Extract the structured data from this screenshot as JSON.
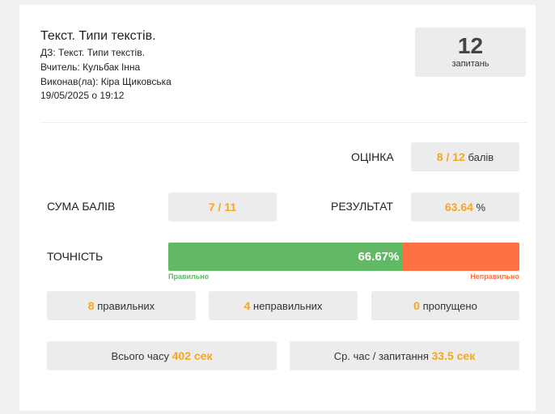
{
  "header": {
    "title": "Текст. Типи текстів.",
    "homework": "ДЗ: Текст. Типи текстів.",
    "teacher": "Вчитель: Кульбак Інна",
    "performer": "Виконав(ла): Кіра Щиковська",
    "datetime": "19/05/2025 о 19:12"
  },
  "questions": {
    "count": "12",
    "label": "запитань"
  },
  "grade": {
    "label": "ОЦІНКА",
    "value": "8 / 12",
    "unit": "балів"
  },
  "score": {
    "label": "СУМА БАЛІВ",
    "value": "7 / 11"
  },
  "result": {
    "label": "РЕЗУЛЬТАТ",
    "value": "63.64",
    "unit": "%"
  },
  "accuracy": {
    "label": "ТОЧНІСТЬ",
    "value_text": "66.67%",
    "fraction": 0.6667,
    "correct_legend": "Правильно",
    "incorrect_legend": "Неправильно",
    "correct_color": "#61b865",
    "incorrect_color": "#ff7043"
  },
  "counts": {
    "correct": {
      "value": "8",
      "label": "правильних"
    },
    "incorrect": {
      "value": "4",
      "label": "неправильних"
    },
    "skipped": {
      "value": "0",
      "label": "пропущено"
    }
  },
  "time": {
    "total_label": "Всього часу",
    "total_value": "402 сек",
    "avg_label": "Ср. час / запитання",
    "avg_value": "33.5 сек"
  },
  "colors": {
    "accent": "#f5a623",
    "box_bg": "#ececec"
  }
}
